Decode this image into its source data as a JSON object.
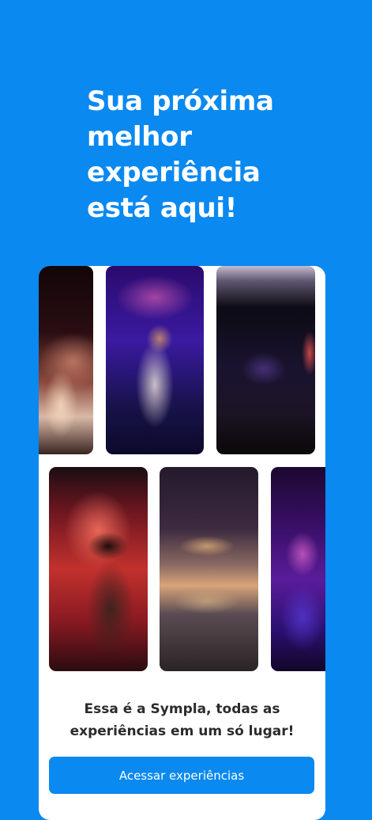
{
  "hero": {
    "headline_lines": [
      "Sua próxima",
      "melhor",
      "experiência",
      "está aqui!"
    ]
  },
  "card": {
    "photos": [
      {
        "name": "concert-crowd-photo"
      },
      {
        "name": "singer-microphone-photo"
      },
      {
        "name": "conference-stage-photo"
      },
      {
        "name": "cowgirl-singer-photo"
      },
      {
        "name": "museum-building-photo"
      },
      {
        "name": "party-crowd-photo"
      }
    ],
    "tagline_lines": [
      "Essa é a Sympla, todas as",
      "experiências em um só lugar!"
    ],
    "cta_label": "Acessar experiências"
  },
  "colors": {
    "background": "#0a89f0",
    "card": "#ffffff",
    "button": "#0a89f0",
    "tagline_text": "#2b2b2b"
  }
}
